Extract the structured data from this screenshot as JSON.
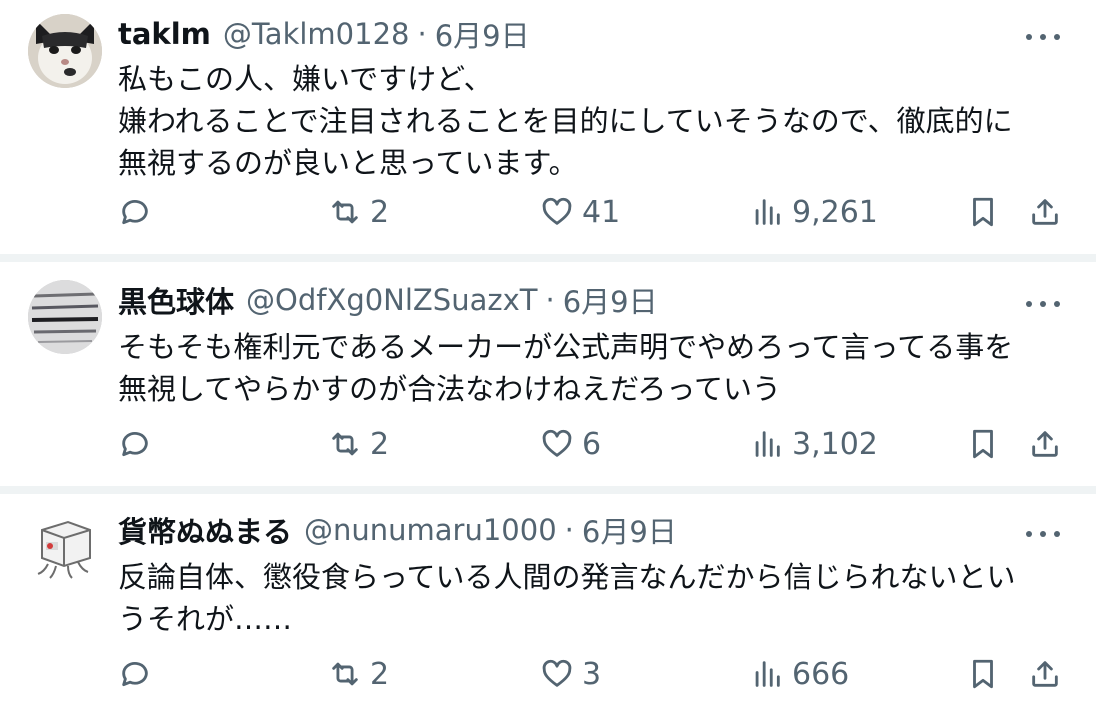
{
  "tweets": [
    {
      "name": "taklm",
      "handle": "@Taklm0128",
      "separator": "·",
      "date": "6月9日",
      "text": "私もこの人、嫌いですけど、\n嫌われることで注目されることを目的にしていそうなので、徹底的に\n無視するのが良いと思っています。",
      "retweets": "2",
      "likes": "41",
      "views": "9,261"
    },
    {
      "name": "黒色球体",
      "handle": "@OdfXg0NlZSuazxT",
      "separator": "·",
      "date": "6月9日",
      "text": "そもそも権利元であるメーカーが公式声明でやめろって言ってる事を\n無視してやらかすのが合法なわけねえだろっていう",
      "retweets": "2",
      "likes": "6",
      "views": "3,102"
    },
    {
      "name": "貨幣ぬぬまる",
      "handle": "@nunumaru1000",
      "separator": "·",
      "date": "6月9日",
      "text": "反論自体、懲役食らっている人間の発言なんだから信じられないとい\nうそれが……",
      "retweets": "2",
      "likes": "3",
      "views": "666"
    }
  ],
  "icons": {
    "more": "more-icon",
    "reply": "reply-icon",
    "retweet": "retweet-icon",
    "like": "heart-icon",
    "views": "views-icon",
    "bookmark": "bookmark-icon",
    "share": "share-icon"
  },
  "colors": {
    "text": "#0f1419",
    "secondary": "#536471",
    "divider": "#eff3f4"
  }
}
